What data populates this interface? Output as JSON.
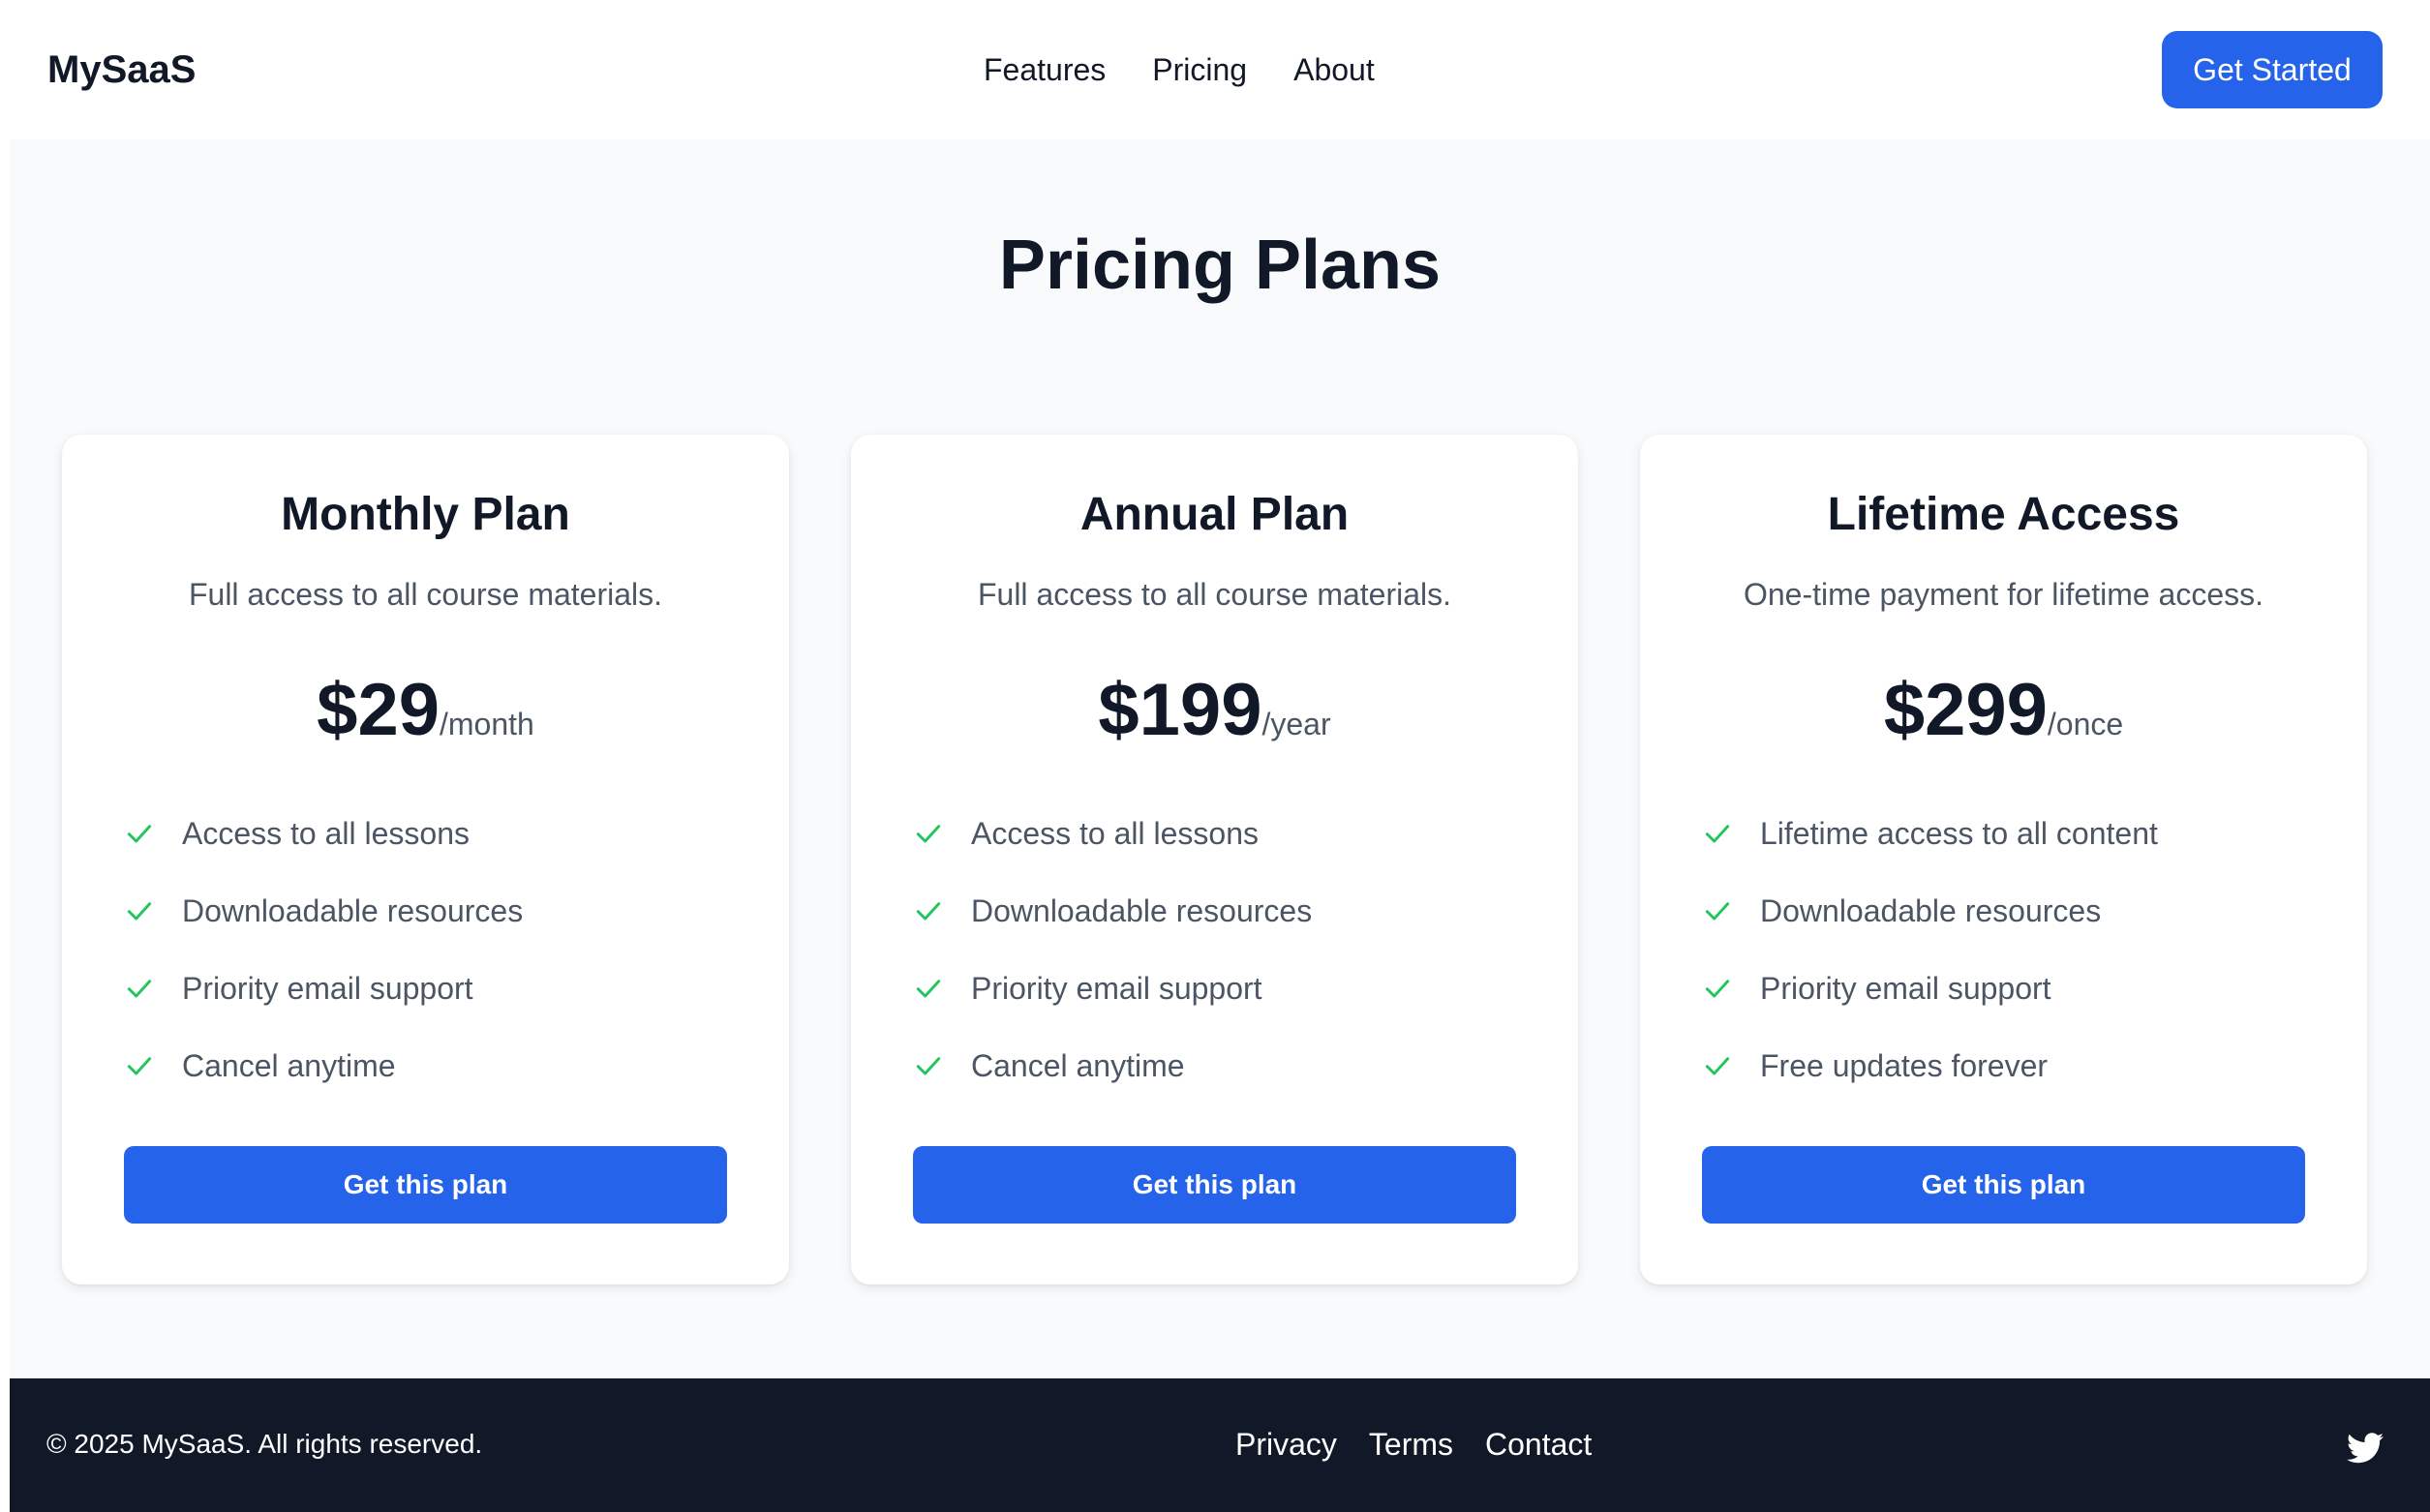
{
  "header": {
    "logo": "MySaaS",
    "nav": [
      {
        "label": "Features"
      },
      {
        "label": "Pricing"
      },
      {
        "label": "About"
      }
    ],
    "cta_label": "Get Started"
  },
  "main": {
    "title": "Pricing Plans",
    "plans": [
      {
        "name": "Monthly Plan",
        "description": "Full access to all course materials.",
        "price": "$29",
        "period": "/month",
        "features": [
          "Access to all lessons",
          "Downloadable resources",
          "Priority email support",
          "Cancel anytime"
        ],
        "button_label": "Get this plan"
      },
      {
        "name": "Annual Plan",
        "description": "Full access to all course materials.",
        "price": "$199",
        "period": "/year",
        "features": [
          "Access to all lessons",
          "Downloadable resources",
          "Priority email support",
          "Cancel anytime"
        ],
        "button_label": "Get this plan"
      },
      {
        "name": "Lifetime Access",
        "description": "One-time payment for lifetime access.",
        "price": "$299",
        "period": "/once",
        "features": [
          "Lifetime access to all content",
          "Downloadable resources",
          "Priority email support",
          "Free updates forever"
        ],
        "button_label": "Get this plan"
      }
    ]
  },
  "footer": {
    "copyright": "© 2025 MySaaS. All rights reserved.",
    "links": [
      {
        "label": "Privacy"
      },
      {
        "label": "Terms"
      },
      {
        "label": "Contact"
      }
    ],
    "social_icon": "twitter-icon"
  },
  "colors": {
    "accent": "#2563eb",
    "check": "#22c55e",
    "text_dark": "#111827",
    "text_muted": "#4b5563",
    "page_bg": "#f9fafb",
    "footer_bg": "#111827"
  }
}
